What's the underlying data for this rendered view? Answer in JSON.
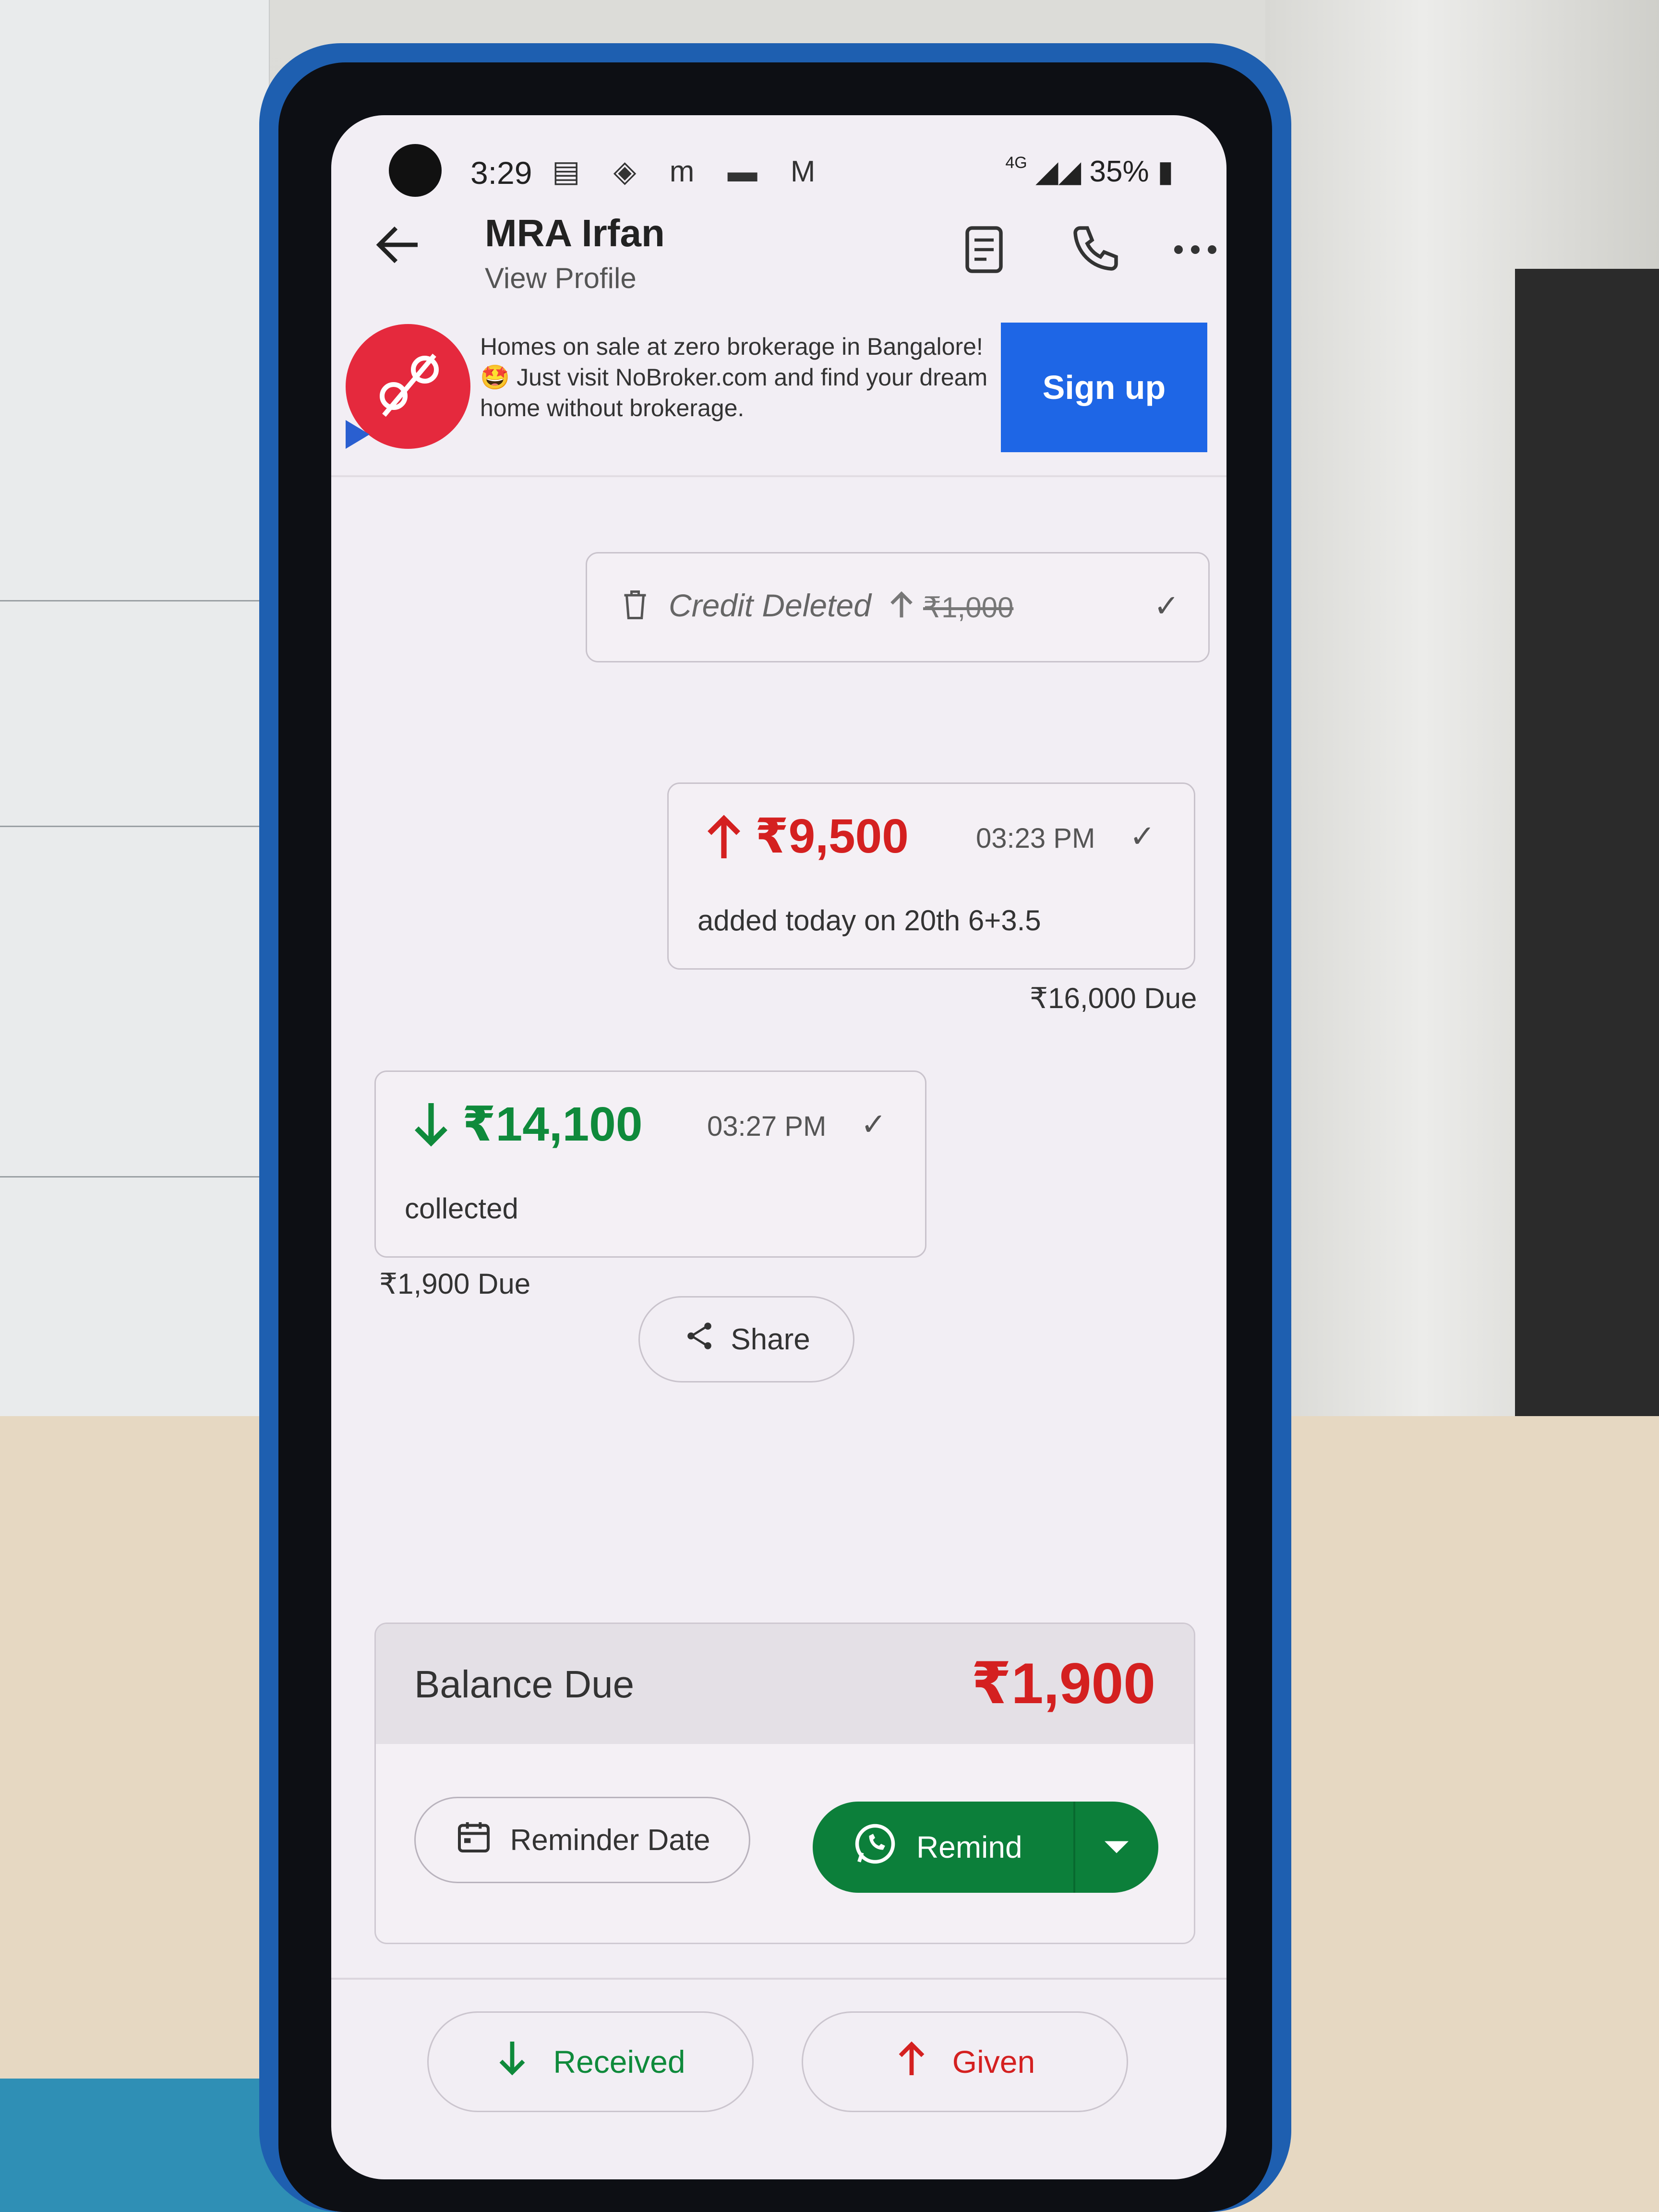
{
  "status_bar": {
    "time": "3:29",
    "notification_icons": "▤ ◈ m ▬ M",
    "network": "4G",
    "battery": "35%"
  },
  "header": {
    "contact_name": "MRA Irfan",
    "subtitle": "View Profile",
    "icons": [
      "back-arrow-icon",
      "report-icon",
      "phone-icon",
      "more-icon"
    ]
  },
  "ad": {
    "text": "Homes on sale at zero brokerage in Bangalore!🤩 Just visit NoBroker.com and find your dream home without brokerage.",
    "button_label": "Sign up",
    "logo_symbol": "%"
  },
  "transactions": [
    {
      "type": "deleted",
      "label": "Credit Deleted",
      "amount": "₹1,000"
    },
    {
      "type": "given",
      "amount": "₹9,500",
      "time": "03:23 PM",
      "note": "added today on 20th 6+3.5",
      "due": "₹16,000 Due"
    },
    {
      "type": "received",
      "amount": "₹14,100",
      "time": "03:27 PM",
      "note": "collected",
      "due": "₹1,900 Due"
    }
  ],
  "share_label": "Share",
  "balance": {
    "label": "Balance Due",
    "amount": "₹1,900",
    "reminder_label": "Reminder Date",
    "remind_label": "Remind"
  },
  "actions": {
    "received_label": "Received",
    "given_label": "Given"
  },
  "colors": {
    "accent_red": "#d42020",
    "accent_green": "#0f8a3b",
    "whatsapp_green": "#0c7f3a",
    "signup_blue": "#1e66e6"
  }
}
